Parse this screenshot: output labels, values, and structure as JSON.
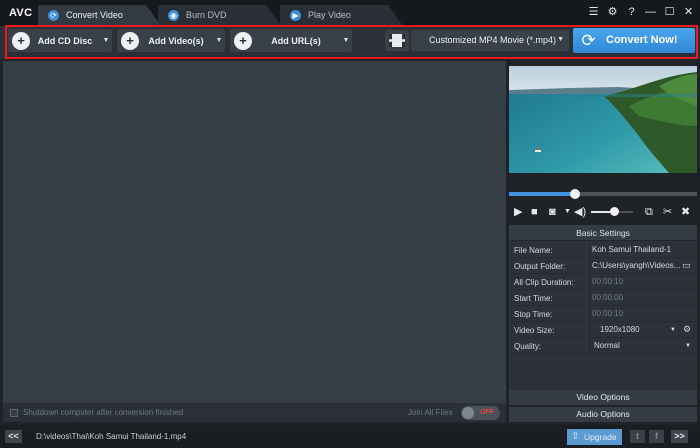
{
  "app": {
    "logo": "AVC"
  },
  "tabs": [
    {
      "label": "Convert Video",
      "icon": "refresh-icon",
      "active": true
    },
    {
      "label": "Burn DVD",
      "icon": "disc-icon",
      "active": false
    },
    {
      "label": "Play Video",
      "icon": "play-circle-icon",
      "active": false
    }
  ],
  "window_controls": {
    "menu": "☰",
    "settings": "⚙",
    "help": "?",
    "minimize": "—",
    "maximize": "☐",
    "close": "✕"
  },
  "toolbar": {
    "add_cd": "Add CD Disc",
    "add_video": "Add Video(s)",
    "add_url": "Add URL(s)",
    "format": "Customized MP4 Movie (*.mp4)",
    "convert": "Convert Now!"
  },
  "bottom_options": {
    "shutdown": "Shutdown computer after conversion finished",
    "join": "Join All Files",
    "toggle": "OFF"
  },
  "player": {
    "progress": 0.35,
    "volume": 0.55
  },
  "settings": {
    "title": "Basic Settings",
    "rows": [
      {
        "label": "File Name:",
        "value": "Koh Samui Thailand-1"
      },
      {
        "label": "Output Folder:",
        "value": "C:\\Users\\yangh\\Videos..."
      },
      {
        "label": "All Clip Duration:",
        "value": "00:00:10"
      },
      {
        "label": "Start Time:",
        "value": "00:00:00"
      },
      {
        "label": "Stop Time:",
        "value": "00:00:10"
      },
      {
        "label": "Video Size:",
        "value": "1920x1080"
      },
      {
        "label": "Quality:",
        "value": "Normal"
      }
    ]
  },
  "panels": {
    "video_options": "Video Options",
    "audio_options": "Audio Options"
  },
  "status": {
    "prev": "<<",
    "path": "D:\\videos\\Thai\\Koh Samui Thailand-1.mp4",
    "upgrade": "Upgrade",
    "twitter": "t",
    "facebook": "f",
    "next": ">>"
  },
  "colors": {
    "accent": "#3e93dc",
    "highlight": "#e41b23",
    "toggle_off": "#e2484a"
  }
}
